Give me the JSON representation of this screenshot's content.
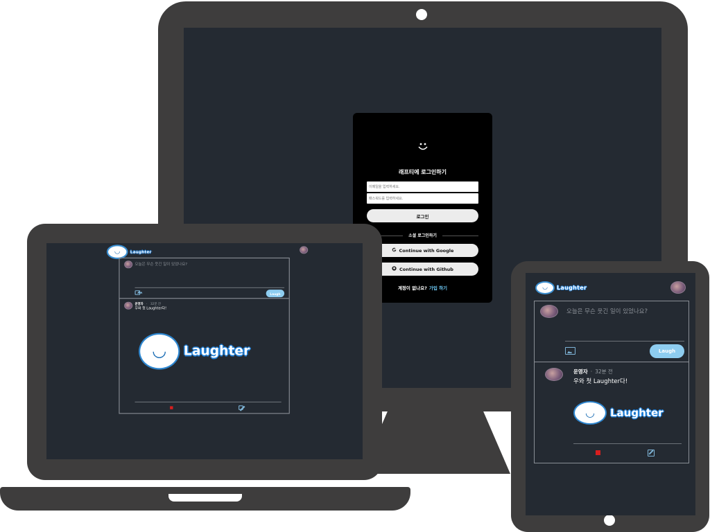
{
  "login": {
    "smile": "◡̈",
    "title": "래프티에 로그인하기",
    "email_placeholder": "이메일을 입력하세요.",
    "password_placeholder": "패스워드를 입력하세요.",
    "login_button": "로그인",
    "social_label": "소셜 로그인하기",
    "google_button": "Continue with Google",
    "github_button": "Continue with Github",
    "signup_prompt": "계정이 없나요?",
    "signup_link": "가입 하기"
  },
  "app": {
    "logo_text": "Laughter",
    "compose_placeholder": "오늘은 무슨 웃긴 일이 있었나요?",
    "laugh_button": "Laugh",
    "post": {
      "author": "운영자",
      "separator": "·",
      "time": "32분 전",
      "text": "우와 첫 Laughter다!",
      "image_text": "Laughter"
    }
  },
  "colors": {
    "device_frame": "#3e3d3d",
    "screen_bg": "#242a32",
    "accent": "#8ecdf0",
    "delete": "#d91e1e"
  },
  "icons": [
    "google-icon",
    "github-icon",
    "image-upload-icon",
    "delete-icon",
    "edit-icon",
    "smiley-logo-icon"
  ]
}
